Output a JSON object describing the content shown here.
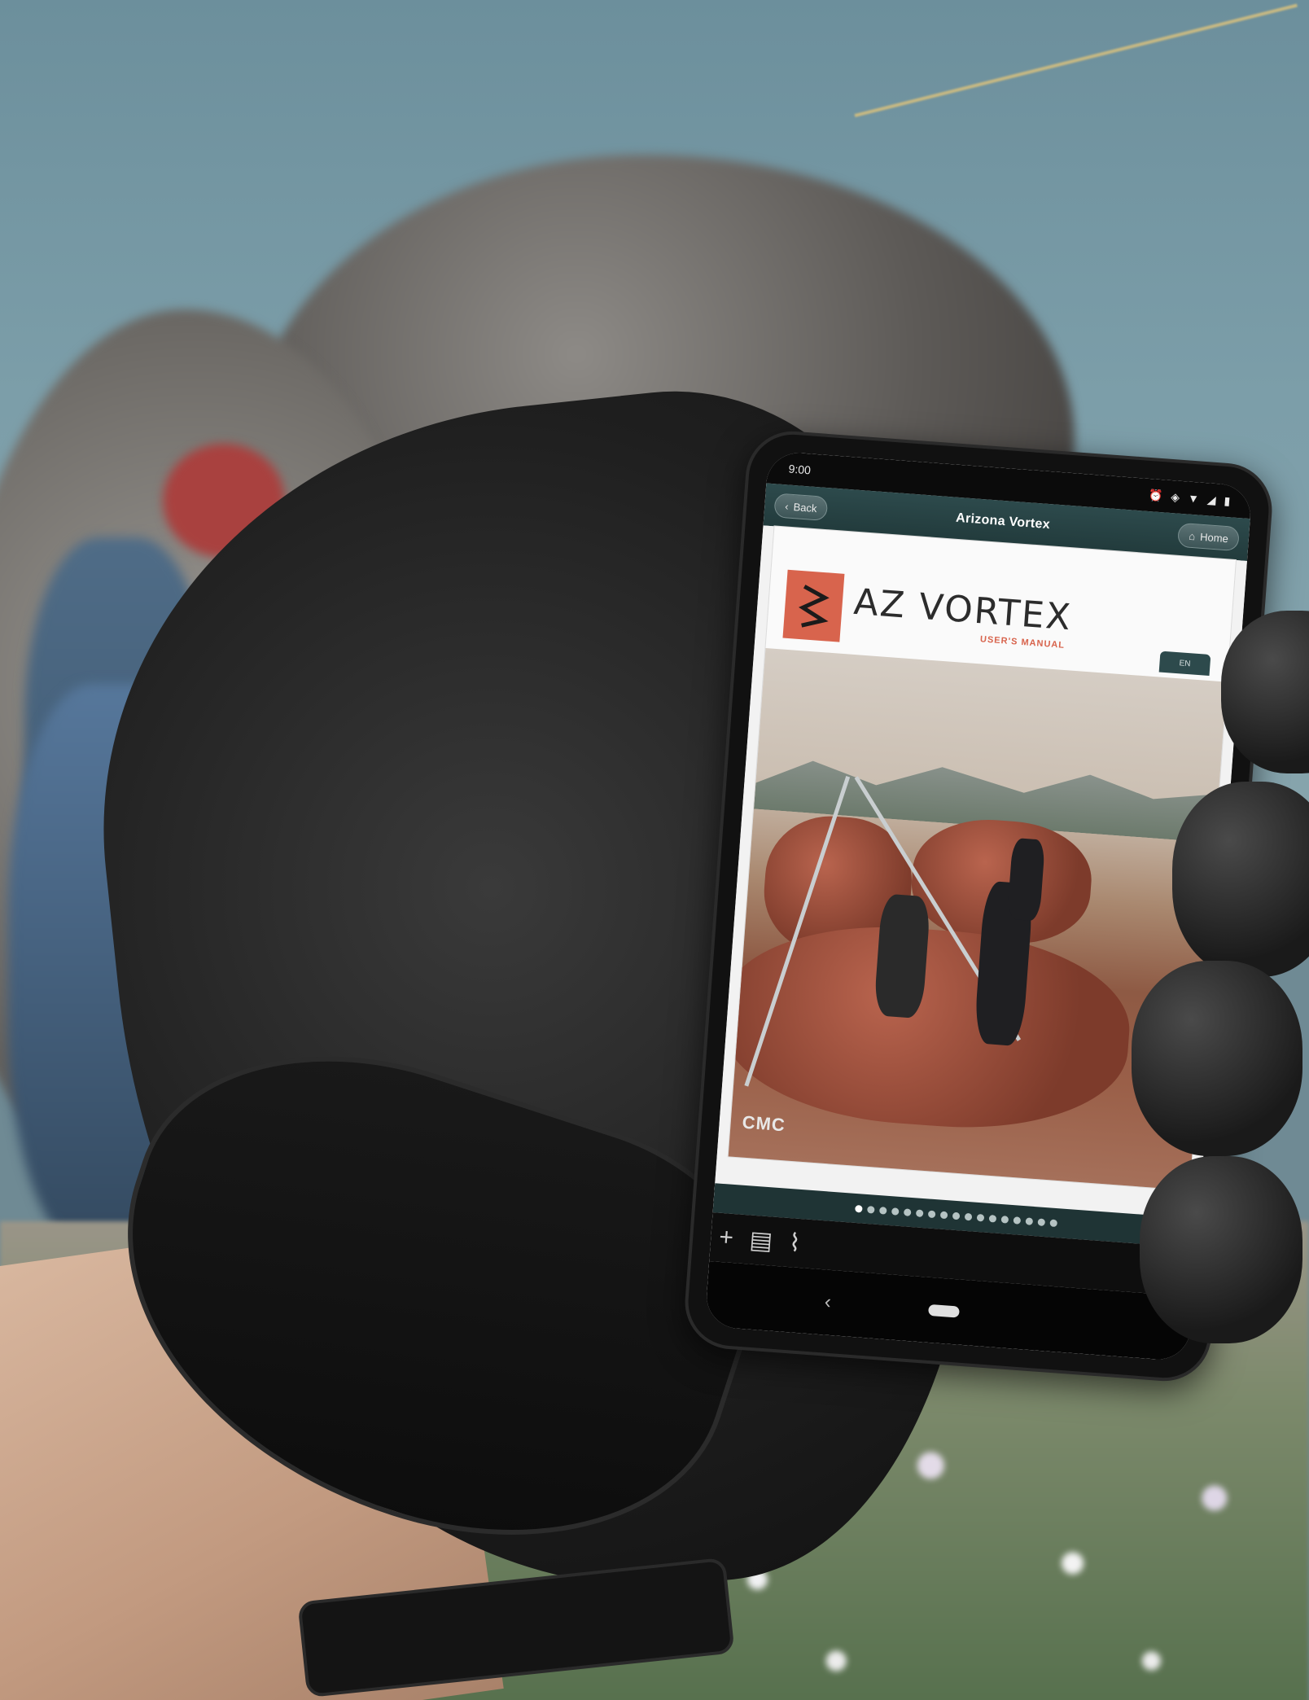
{
  "statusbar": {
    "time": "9:00",
    "icons": [
      "alarm-icon",
      "vibrate-icon",
      "wifi-icon",
      "signal-icon",
      "battery-icon"
    ]
  },
  "appbar": {
    "back_label": "Back",
    "title": "Arizona Vortex",
    "home_label": "Home"
  },
  "document": {
    "logo_text": "AZ VORTEX",
    "subtitle": "USER'S MANUAL",
    "tab_label": "EN",
    "publisher_mark": "CMC"
  },
  "pager": {
    "page_count": 17,
    "current_page": 1
  },
  "toolbar": {
    "icons": [
      "add-icon",
      "notes-icon",
      "attachment-icon",
      "inbox-icon"
    ]
  },
  "colors": {
    "appbar": "#2d4a4c",
    "logo_accent": "#d8644d"
  }
}
